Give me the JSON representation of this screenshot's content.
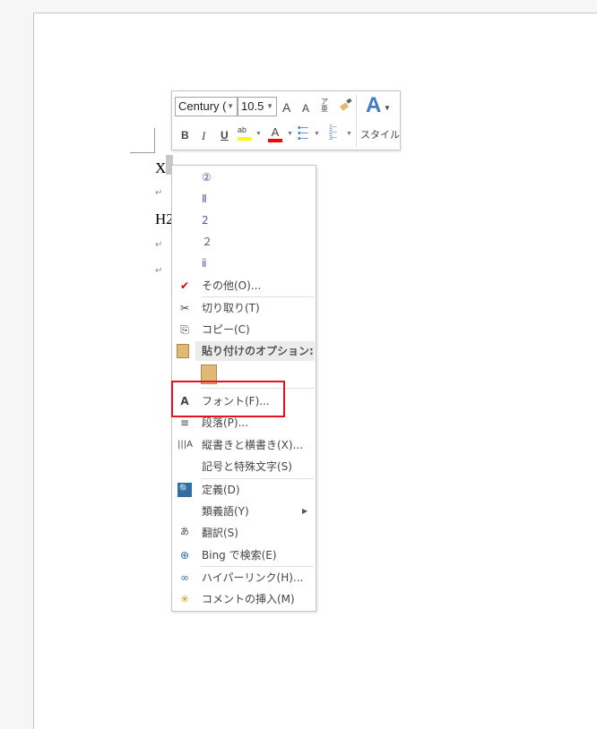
{
  "document": {
    "line1": "X2",
    "line2": "H2",
    "para_mark": "↵"
  },
  "mini_toolbar": {
    "font_name": "Century (",
    "font_size": "10.5",
    "grow_font": "A",
    "shrink_font": "A",
    "phonetic": "ア亜",
    "bold": "B",
    "italic": "I",
    "underline": "U",
    "highlight": "ab",
    "font_color": "A",
    "styles_label": "スタイル",
    "highlight_color": "#ffff00",
    "font_color_value": "#ff0000"
  },
  "context_menu": {
    "number_options": [
      "②",
      "Ⅱ",
      "2",
      "２",
      "ⅱ"
    ],
    "more": "その他(O)...",
    "cut": "切り取り(T)",
    "copy": "コピー(C)",
    "paste_options": "貼り付けのオプション:",
    "font": "フォント(F)...",
    "paragraph": "段落(P)...",
    "text_direction": "縦書きと横書き(X)...",
    "symbols": "記号と特殊文字(S)",
    "define": "定義(D)",
    "synonyms": "類義語(Y)",
    "translate": "翻訳(S)",
    "bing": "Bing で検索(E)",
    "hyperlink": "ハイパーリンク(H)...",
    "comment": "コメントの挿入(M)"
  },
  "highlight_box_color": "#e81123"
}
